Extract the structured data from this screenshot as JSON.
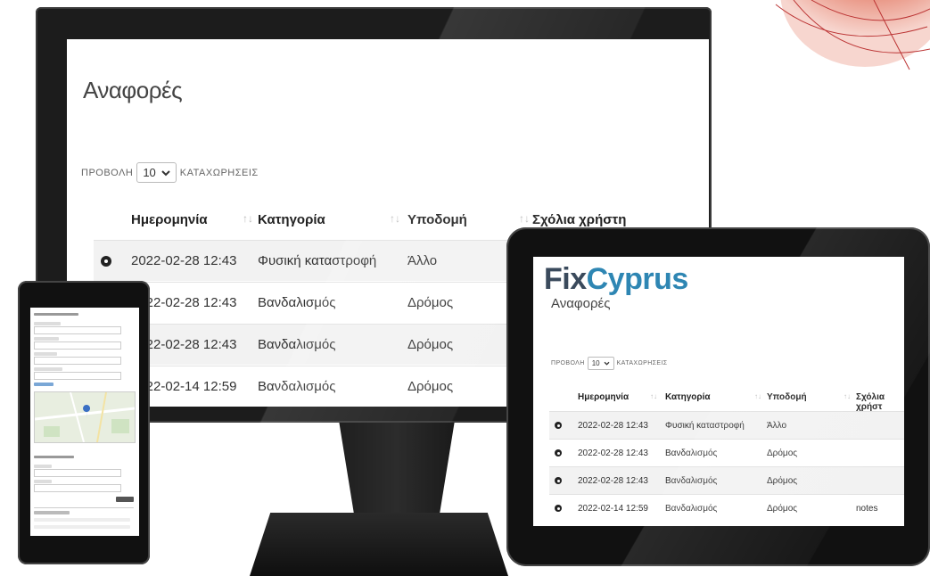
{
  "monitor": {
    "page_title": "Αναφορές",
    "show_prefix": "ΠΡΟΒΟΛΗ",
    "page_size": "10",
    "show_suffix": "ΚΑΤΑΧΩΡΗΣΕΙΣ",
    "columns": [
      "Ημερομηνία",
      "Κατηγορία",
      "Υποδομή",
      "Σχόλια χρήστη"
    ],
    "rows": [
      {
        "date": "2022-02-28 12:43",
        "category": "Φυσική καταστροφή",
        "infrastructure": "Άλλο"
      },
      {
        "date": "2022-02-28 12:43",
        "category": "Βανδαλισμός",
        "infrastructure": "Δρόμος"
      },
      {
        "date": "2022-02-28 12:43",
        "category": "Βανδαλισμός",
        "infrastructure": "Δρόμος"
      },
      {
        "date": "2022-02-14 12:59",
        "category": "Βανδαλισμός",
        "infrastructure": "Δρόμος"
      }
    ]
  },
  "tablet": {
    "logo_fix": "Fix",
    "logo_cyprus": "Cyprus",
    "page_title": "Αναφορές",
    "show_prefix": "ΠΡΟΒΟΛΗ",
    "page_size": "10",
    "show_suffix": "ΚΑΤΑΧΩΡΗΣΕΙΣ",
    "columns": [
      "Ημερομηνία",
      "Κατηγορία",
      "Υποδομή",
      "Σχόλια χρήστ"
    ],
    "rows": [
      {
        "date": "2022-02-28 12:43",
        "category": "Φυσική καταστροφή",
        "infrastructure": "Άλλο",
        "comment": ""
      },
      {
        "date": "2022-02-28 12:43",
        "category": "Βανδαλισμός",
        "infrastructure": "Δρόμος",
        "comment": ""
      },
      {
        "date": "2022-02-28 12:43",
        "category": "Βανδαλισμός",
        "infrastructure": "Δρόμος",
        "comment": ""
      },
      {
        "date": "2022-02-14 12:59",
        "category": "Βανδαλισμός",
        "infrastructure": "Δρόμος",
        "comment": "notes"
      }
    ]
  },
  "colors": {
    "logo_dark": "#3a4a5c",
    "logo_accent": "#2e86b3",
    "device_body": "#111111",
    "row_stripe": "#f2f2f2"
  },
  "icons": [
    "eye-icon",
    "chevron-down-icon",
    "sort-icon",
    "map-marker-icon"
  ]
}
